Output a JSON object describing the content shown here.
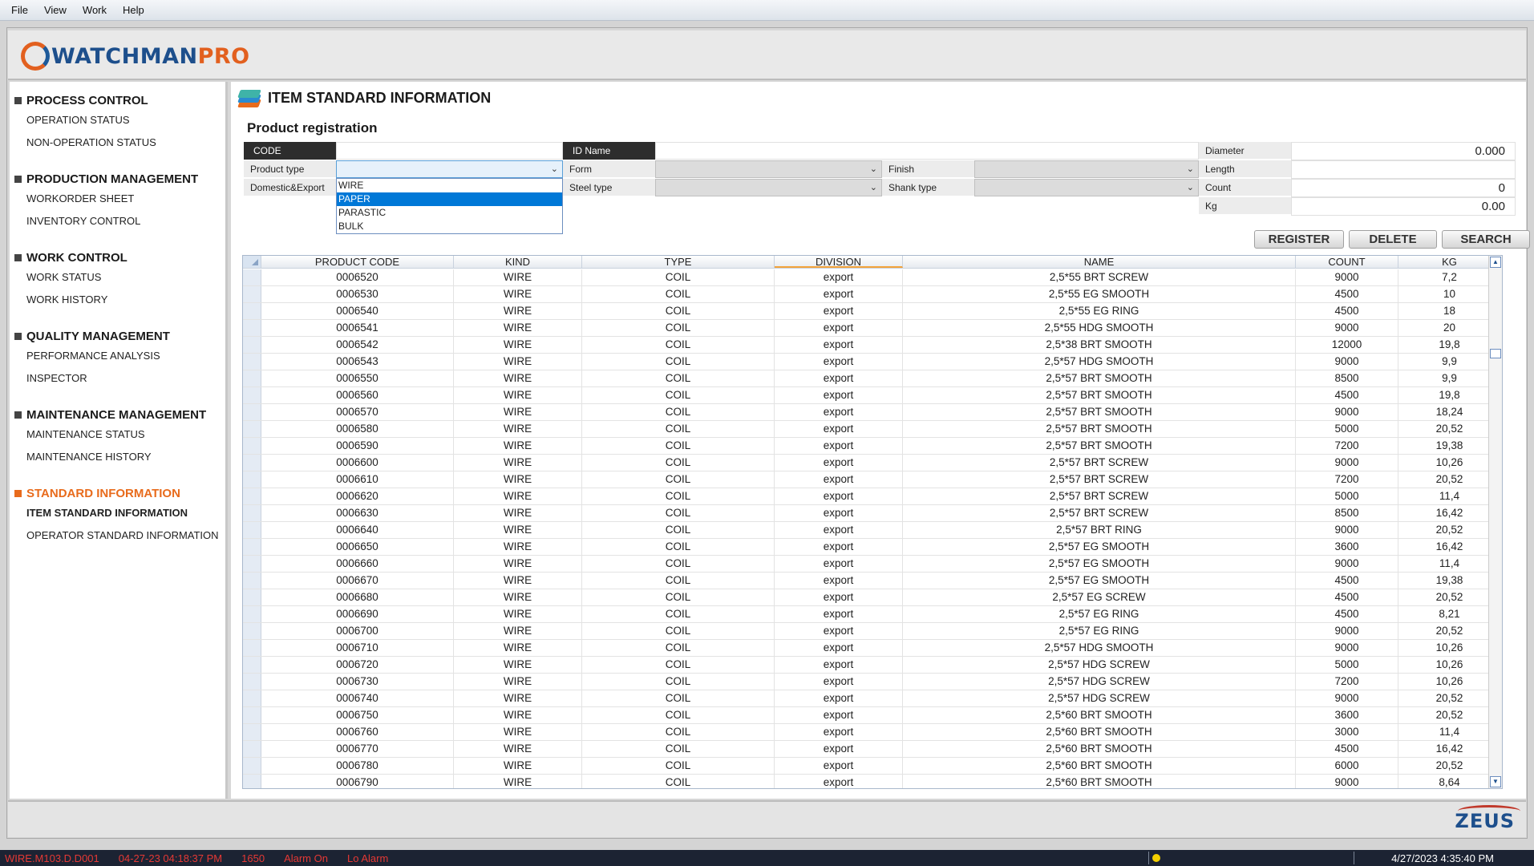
{
  "menu": [
    "File",
    "View",
    "Work",
    "Help"
  ],
  "logo": {
    "brand": "WATCHMAN",
    "brand_accent": "PRO",
    "footer": "ZEUS"
  },
  "colors": {
    "accent_orange": "#e86b1c",
    "brand_blue": "#1d4f8c",
    "selection_blue": "#0078d7",
    "alarm_red": "#e53935"
  },
  "sidebar": [
    {
      "title": "PROCESS CONTROL",
      "items": [
        "OPERATION STATUS",
        "NON-OPERATION STATUS"
      ]
    },
    {
      "title": "PRODUCTION MANAGEMENT",
      "items": [
        "WORKORDER SHEET",
        "INVENTORY CONTROL"
      ]
    },
    {
      "title": "WORK CONTROL",
      "items": [
        "WORK STATUS",
        "WORK HISTORY"
      ]
    },
    {
      "title": "QUALITY MANAGEMENT",
      "items": [
        "PERFORMANCE ANALYSIS",
        "INSPECTOR"
      ]
    },
    {
      "title": "MAINTENANCE MANAGEMENT",
      "items": [
        "MAINTENANCE STATUS",
        "MAINTENANCE HISTORY"
      ]
    },
    {
      "title": "STANDARD INFORMATION",
      "items": [
        "ITEM STANDARD INFORMATION",
        "OPERATOR STANDARD INFORMATION"
      ]
    }
  ],
  "page": {
    "title": "ITEM STANDARD INFORMATION",
    "subtitle": "Product registration"
  },
  "form": {
    "code_label": "CODE",
    "id_name_label": "ID Name",
    "product_type_label": "Product type",
    "domestic_export_label": "Domestic&Export",
    "form_label": "Form",
    "steel_type_label": "Steel type",
    "finish_label": "Finish",
    "shank_type_label": "Shank type",
    "diameter_label": "Diameter",
    "diameter_value": "0.000",
    "length_label": "Length",
    "length_value": "",
    "count_label": "Count",
    "count_value": "0",
    "kg_label": "Kg",
    "kg_value": "0.00",
    "product_type_options": [
      "WIRE",
      "PAPER",
      "PARASTIC",
      "BULK"
    ],
    "product_type_highlighted": "PAPER"
  },
  "buttons": {
    "register": "REGISTER",
    "delete": "DELETE",
    "search": "SEARCH"
  },
  "table": {
    "columns": [
      "PRODUCT CODE",
      "KIND",
      "TYPE",
      "DIVISION",
      "NAME",
      "COUNT",
      "KG"
    ],
    "rows": [
      [
        "0006520",
        "WIRE",
        "COIL",
        "export",
        "2,5*55 BRT SCREW",
        "9000",
        "7,2"
      ],
      [
        "0006530",
        "WIRE",
        "COIL",
        "export",
        "2,5*55 EG SMOOTH",
        "4500",
        "10"
      ],
      [
        "0006540",
        "WIRE",
        "COIL",
        "export",
        "2,5*55 EG RING",
        "4500",
        "18"
      ],
      [
        "0006541",
        "WIRE",
        "COIL",
        "export",
        "2,5*55 HDG SMOOTH",
        "9000",
        "20"
      ],
      [
        "0006542",
        "WIRE",
        "COIL",
        "export",
        "2,5*38 BRT SMOOTH",
        "12000",
        "19,8"
      ],
      [
        "0006543",
        "WIRE",
        "COIL",
        "export",
        "2,5*57 HDG SMOOTH",
        "9000",
        "9,9"
      ],
      [
        "0006550",
        "WIRE",
        "COIL",
        "export",
        "2,5*57 BRT SMOOTH",
        "8500",
        "9,9"
      ],
      [
        "0006560",
        "WIRE",
        "COIL",
        "export",
        "2,5*57 BRT SMOOTH",
        "4500",
        "19,8"
      ],
      [
        "0006570",
        "WIRE",
        "COIL",
        "export",
        "2,5*57 BRT SMOOTH",
        "9000",
        "18,24"
      ],
      [
        "0006580",
        "WIRE",
        "COIL",
        "export",
        "2,5*57 BRT SMOOTH",
        "5000",
        "20,52"
      ],
      [
        "0006590",
        "WIRE",
        "COIL",
        "export",
        "2,5*57 BRT SMOOTH",
        "7200",
        "19,38"
      ],
      [
        "0006600",
        "WIRE",
        "COIL",
        "export",
        "2,5*57 BRT SCREW",
        "9000",
        "10,26"
      ],
      [
        "0006610",
        "WIRE",
        "COIL",
        "export",
        "2,5*57 BRT SCREW",
        "7200",
        "20,52"
      ],
      [
        "0006620",
        "WIRE",
        "COIL",
        "export",
        "2,5*57 BRT SCREW",
        "5000",
        "11,4"
      ],
      [
        "0006630",
        "WIRE",
        "COIL",
        "export",
        "2,5*57 BRT SCREW",
        "8500",
        "16,42"
      ],
      [
        "0006640",
        "WIRE",
        "COIL",
        "export",
        "2,5*57 BRT RING",
        "9000",
        "20,52"
      ],
      [
        "0006650",
        "WIRE",
        "COIL",
        "export",
        "2,5*57 EG SMOOTH",
        "3600",
        "16,42"
      ],
      [
        "0006660",
        "WIRE",
        "COIL",
        "export",
        "2,5*57 EG SMOOTH",
        "9000",
        "11,4"
      ],
      [
        "0006670",
        "WIRE",
        "COIL",
        "export",
        "2,5*57 EG SMOOTH",
        "4500",
        "19,38"
      ],
      [
        "0006680",
        "WIRE",
        "COIL",
        "export",
        "2,5*57 EG SCREW",
        "4500",
        "20,52"
      ],
      [
        "0006690",
        "WIRE",
        "COIL",
        "export",
        "2,5*57 EG RING",
        "4500",
        "8,21"
      ],
      [
        "0006700",
        "WIRE",
        "COIL",
        "export",
        "2,5*57 EG RING",
        "9000",
        "20,52"
      ],
      [
        "0006710",
        "WIRE",
        "COIL",
        "export",
        "2,5*57 HDG SMOOTH",
        "9000",
        "10,26"
      ],
      [
        "0006720",
        "WIRE",
        "COIL",
        "export",
        "2,5*57 HDG SCREW",
        "5000",
        "10,26"
      ],
      [
        "0006730",
        "WIRE",
        "COIL",
        "export",
        "2,5*57 HDG SCREW",
        "7200",
        "10,26"
      ],
      [
        "0006740",
        "WIRE",
        "COIL",
        "export",
        "2,5*57 HDG SCREW",
        "9000",
        "20,52"
      ],
      [
        "0006750",
        "WIRE",
        "COIL",
        "export",
        "2,5*60 BRT SMOOTH",
        "3600",
        "20,52"
      ],
      [
        "0006760",
        "WIRE",
        "COIL",
        "export",
        "2,5*60 BRT SMOOTH",
        "3000",
        "11,4"
      ],
      [
        "0006770",
        "WIRE",
        "COIL",
        "export",
        "2,5*60 BRT SMOOTH",
        "4500",
        "16,42"
      ],
      [
        "0006780",
        "WIRE",
        "COIL",
        "export",
        "2,5*60 BRT SMOOTH",
        "6000",
        "20,52"
      ],
      [
        "0006790",
        "WIRE",
        "COIL",
        "export",
        "2,5*60 BRT SMOOTH",
        "9000",
        "8,64"
      ]
    ]
  },
  "status": {
    "tag": "WIRE.M103.D.D001",
    "timestamp": "04-27-23 04:18:37 PM",
    "value": "1650",
    "alarm": "Alarm On",
    "level": "Lo Alarm",
    "clock": "4/27/2023 4:35:40 PM"
  }
}
